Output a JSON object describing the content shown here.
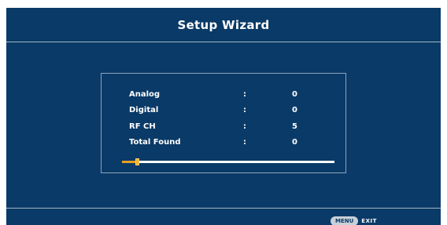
{
  "title": "Setup Wizard",
  "scan_results": [
    {
      "label": "Analog",
      "separator": ":",
      "value": "0"
    },
    {
      "label": "Digital",
      "separator": ":",
      "value": "0"
    },
    {
      "label": "RF CH",
      "separator": ":",
      "value": "5"
    },
    {
      "label": "Total Found",
      "separator": ":",
      "value": "0"
    }
  ],
  "progress": {
    "percent": 7
  },
  "footer": {
    "menu_key": "MENU",
    "exit_label": "EXIT"
  },
  "colors": {
    "background": "#0a3a67",
    "progress_accent": "#e8a020",
    "text": "#ffffff"
  }
}
